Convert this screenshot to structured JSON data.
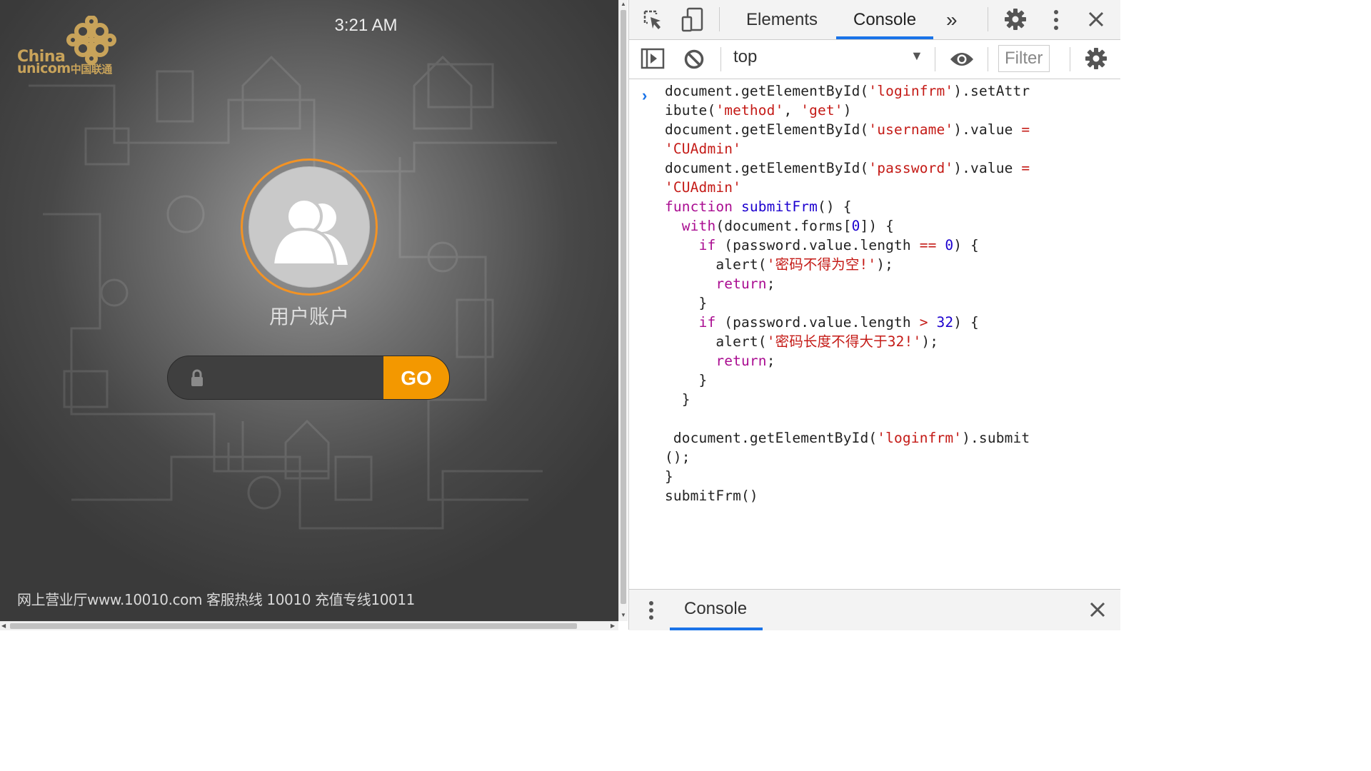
{
  "device": {
    "logo": {
      "brand_en_1": "China",
      "brand_en_2": "unicom",
      "brand_cn": "中国联通"
    },
    "clock": "3:21 AM",
    "account_label": "用户账户",
    "password_placeholder": "",
    "go_label": "GO",
    "footer": "网上营业厅www.10010.com 客服热线 10010 充值专线10011"
  },
  "devtools": {
    "tabs": [
      "Elements",
      "Console"
    ],
    "active_tab": "Console",
    "more_tabs": "»",
    "context": "top",
    "filter_placeholder": "Filter",
    "drawer_tab": "Console",
    "accent_color": "#1a73e8",
    "code_lines": [
      "document.getElementById('loginfrm').setAttr",
      "ibute('method', 'get')",
      "document.getElementById('username').value =",
      "'CUAdmin'",
      "document.getElementById('password').value =",
      "'CUAdmin'",
      "function submitFrm() {",
      "  with(document.forms[0]) {",
      "    if (password.value.length == 0) {",
      "      alert('密码不得为空!');",
      "      return;",
      "    }",
      "    if (password.value.length > 32) {",
      "      alert('密码长度不得大于32!');",
      "      return;",
      "    }",
      "  }",
      "",
      " document.getElementById('loginfrm').submit",
      "();",
      "}",
      "submitFrm()"
    ]
  },
  "colors": {
    "go_button": "#f39800",
    "avatar_ring": "#f39324",
    "logo_gold": "#c8a35a"
  }
}
